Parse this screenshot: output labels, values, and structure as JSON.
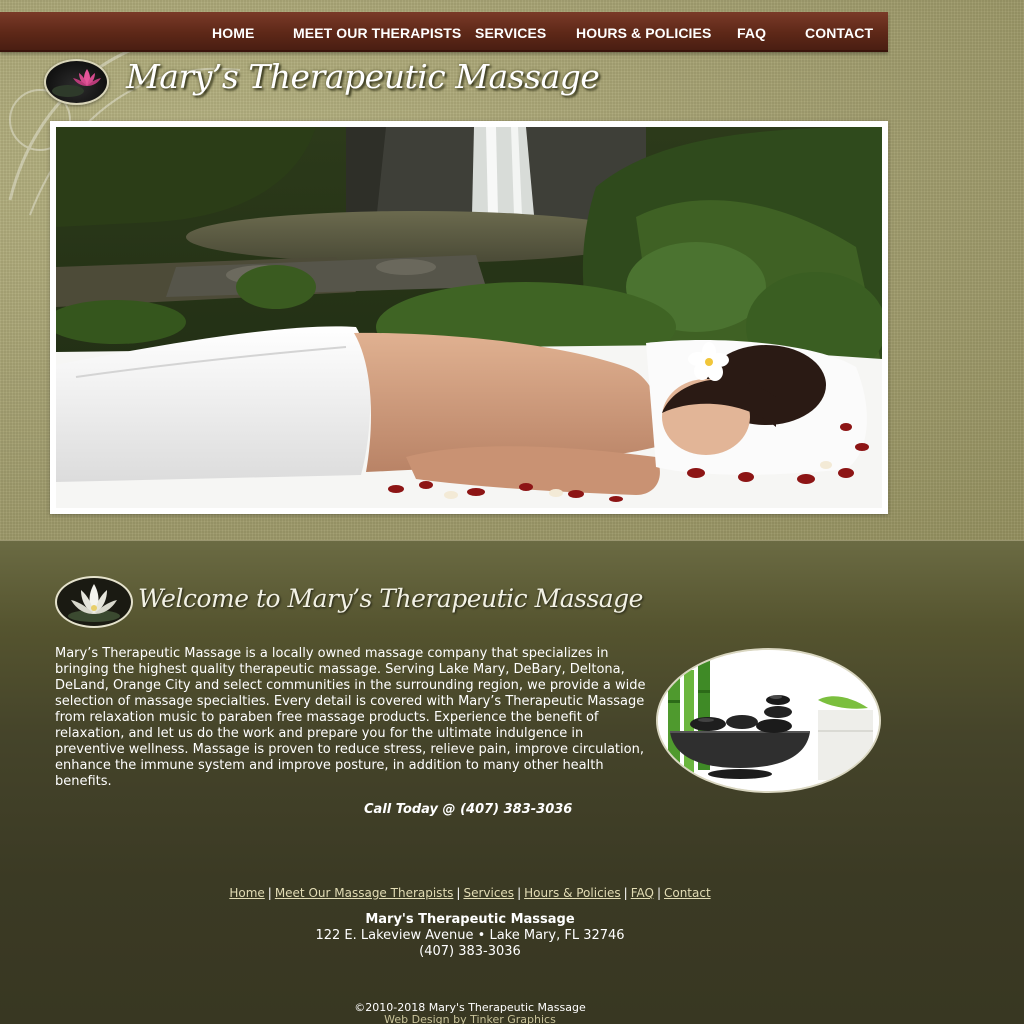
{
  "nav": {
    "items": [
      {
        "label": "HOME"
      },
      {
        "label": "MEET OUR THERAPISTS"
      },
      {
        "label": "SERVICES"
      },
      {
        "label": "HOURS & POLICIES"
      },
      {
        "label": "FAQ"
      },
      {
        "label": "CONTACT"
      }
    ]
  },
  "header": {
    "title": "Mary’s Therapeutic Massage"
  },
  "welcome": {
    "heading": "Welcome to Mary’s Therapeutic Massage",
    "body": "Mary’s Therapeutic Massage is a locally owned massage company that specializes in bringing the highest quality therapeutic massage. Serving Lake Mary, DeBary, Deltona, DeLand, Orange City and select communities in the surrounding region, we provide a wide selection of massage specialties. Every detail is covered with Mary’s Therapeutic Massage from relaxation music to paraben free massage products. Experience the benefit of relaxation, and let us do the work and prepare you for the ultimate indulgence in preventive wellness. Massage is proven to reduce stress, relieve pain, improve circulation, enhance the immune system and improve posture, in addition to many other health benefits.",
    "call": "Call Today @ (407) 383-3036"
  },
  "footer": {
    "links": [
      {
        "label": "Home"
      },
      {
        "label": "Meet Our Massage Therapists"
      },
      {
        "label": "Services"
      },
      {
        "label": "Hours & Policies"
      },
      {
        "label": "FAQ"
      },
      {
        "label": "Contact"
      }
    ],
    "separator": "|",
    "business_name": "Mary's Therapeutic Massage",
    "address": "122 E. Lakeview Avenue • Lake Mary, FL 32746",
    "phone": "(407) 383-3036",
    "copyright": "©2010-2018 Mary's Therapeutic Massage",
    "credit": "Web Design by Tinker Graphics"
  },
  "colors": {
    "nav_bg": "#5e2818",
    "top_texture": "#a6a273",
    "bottom_bg": "#3b3a24",
    "link": "#e2dcb4"
  }
}
